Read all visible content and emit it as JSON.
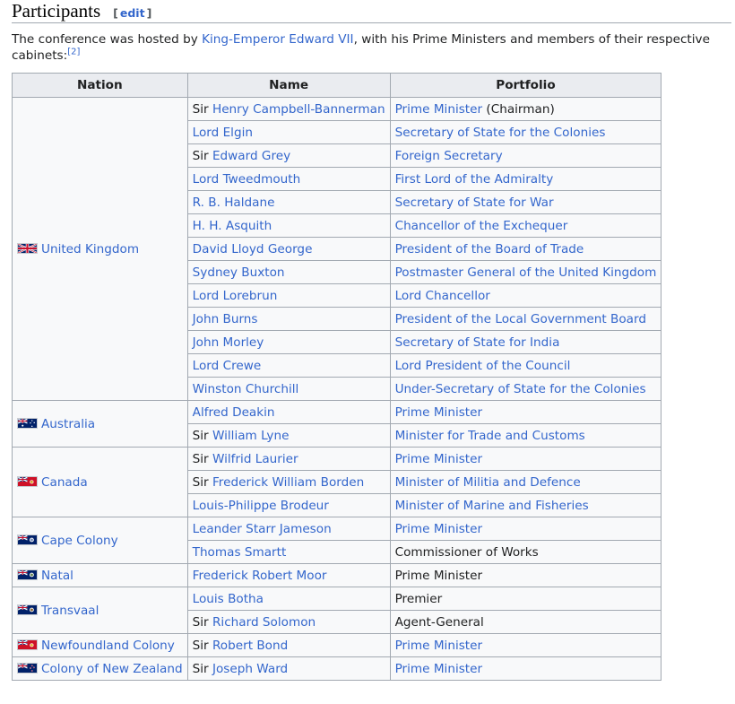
{
  "section": {
    "title": "Participants",
    "edit_open": "[",
    "edit_label": "edit",
    "edit_close": "]"
  },
  "intro": {
    "prefix": "The conference was hosted by ",
    "host_link": "King-Emperor Edward VII",
    "suffix": ", with his Prime Ministers and members of their respective cabinets:",
    "ref": "[2]"
  },
  "table": {
    "headers": [
      "Nation",
      "Name",
      "Portfolio"
    ],
    "groups": [
      {
        "nation": "United Kingdom",
        "flag": "uk-flag-icon",
        "rows": [
          {
            "prefix": "Sir ",
            "name": "Henry Campbell-Bannerman",
            "portfolio": "Prime Minister",
            "portfolio_link": true,
            "portfolio_suffix": " (Chairman)"
          },
          {
            "prefix": "",
            "name": "Lord Elgin",
            "portfolio": "Secretary of State for the Colonies",
            "portfolio_link": true
          },
          {
            "prefix": "Sir ",
            "name": "Edward Grey",
            "portfolio": "Foreign Secretary",
            "portfolio_link": true
          },
          {
            "prefix": "",
            "name": "Lord Tweedmouth",
            "portfolio": "First Lord of the Admiralty",
            "portfolio_link": true
          },
          {
            "prefix": "",
            "name": "R. B. Haldane",
            "portfolio": "Secretary of State for War",
            "portfolio_link": true
          },
          {
            "prefix": "",
            "name": "H. H. Asquith",
            "portfolio": "Chancellor of the Exchequer",
            "portfolio_link": true
          },
          {
            "prefix": "",
            "name": "David Lloyd George",
            "portfolio": "President of the Board of Trade",
            "portfolio_link": true
          },
          {
            "prefix": "",
            "name": "Sydney Buxton",
            "portfolio": "Postmaster General of the United Kingdom",
            "portfolio_link": true
          },
          {
            "prefix": "",
            "name": "Lord Lorebrun",
            "portfolio": "Lord Chancellor",
            "portfolio_link": true
          },
          {
            "prefix": "",
            "name": "John Burns",
            "portfolio": "President of the Local Government Board",
            "portfolio_link": true
          },
          {
            "prefix": "",
            "name": "John Morley",
            "portfolio": "Secretary of State for India",
            "portfolio_link": true
          },
          {
            "prefix": "",
            "name": "Lord Crewe",
            "portfolio": "Lord President of the Council",
            "portfolio_link": true
          },
          {
            "prefix": "",
            "name": "Winston Churchill",
            "portfolio": "Under-Secretary of State for the Colonies",
            "portfolio_link": true
          }
        ]
      },
      {
        "nation": "Australia",
        "flag": "australia-flag-icon",
        "rows": [
          {
            "prefix": "",
            "name": "Alfred Deakin",
            "portfolio": "Prime Minister",
            "portfolio_link": true
          },
          {
            "prefix": "Sir ",
            "name": "William Lyne",
            "portfolio": "Minister for Trade and Customs",
            "portfolio_link": true
          }
        ]
      },
      {
        "nation": "Canada",
        "flag": "canada-flag-icon",
        "rows": [
          {
            "prefix": "Sir ",
            "name": "Wilfrid Laurier",
            "portfolio": "Prime Minister",
            "portfolio_link": true
          },
          {
            "prefix": "Sir ",
            "name": "Frederick William Borden",
            "portfolio": "Minister of Militia and Defence",
            "portfolio_link": true
          },
          {
            "prefix": "",
            "name": "Louis-Philippe Brodeur",
            "portfolio": "Minister of Marine and Fisheries",
            "portfolio_link": true
          }
        ]
      },
      {
        "nation": "Cape Colony",
        "flag": "cape-colony-flag-icon",
        "rows": [
          {
            "prefix": "",
            "name": "Leander Starr Jameson",
            "portfolio": "Prime Minister",
            "portfolio_link": true
          },
          {
            "prefix": "",
            "name": "Thomas Smartt",
            "portfolio": "Commissioner of Works",
            "portfolio_link": false
          }
        ]
      },
      {
        "nation": "Natal",
        "flag": "natal-flag-icon",
        "rows": [
          {
            "prefix": "",
            "name": "Frederick Robert Moor",
            "portfolio": "Prime Minister",
            "portfolio_link": false
          }
        ]
      },
      {
        "nation": "Transvaal",
        "flag": "transvaal-flag-icon",
        "rows": [
          {
            "prefix": "",
            "name": "Louis Botha",
            "portfolio": "Premier",
            "portfolio_link": false
          },
          {
            "prefix": "Sir ",
            "name": "Richard Solomon",
            "portfolio": "Agent-General",
            "portfolio_link": false
          }
        ]
      },
      {
        "nation": "Newfoundland Colony",
        "flag": "newfoundland-flag-icon",
        "rows": [
          {
            "prefix": "Sir ",
            "name": "Robert Bond",
            "portfolio": "Prime Minister",
            "portfolio_link": true
          }
        ]
      },
      {
        "nation": "Colony of New Zealand",
        "flag": "new-zealand-flag-icon",
        "rows": [
          {
            "prefix": "Sir ",
            "name": "Joseph Ward",
            "portfolio": "Prime Minister",
            "portfolio_link": true
          }
        ]
      }
    ]
  },
  "colors": {
    "link": "#3366cc",
    "text": "#202122",
    "border": "#a2a9b1",
    "header_bg": "#eaecf0",
    "cell_bg": "#f8f9fa"
  }
}
